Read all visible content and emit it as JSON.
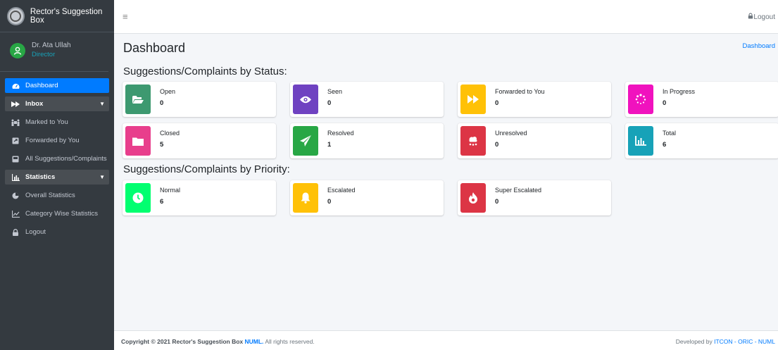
{
  "brand": {
    "title": "Rector's Suggestion Box"
  },
  "user": {
    "name": "Dr. Ata Ullah",
    "role": "Director"
  },
  "nav": {
    "dashboard": "Dashboard",
    "inbox": "Inbox",
    "marked_to_you": "Marked to You",
    "forwarded_by_you": "Forwarded by You",
    "all_suggestions": "All Suggestions/Complaints",
    "statistics": "Statistics",
    "overall_statistics": "Overall Statistics",
    "category_statistics": "Category Wise Statistics",
    "logout": "Logout"
  },
  "topbar": {
    "menu_icon": "≡",
    "logout": "Logout"
  },
  "page": {
    "title": "Dashboard",
    "breadcrumb": "Dashboard",
    "status_section": "Suggestions/Complaints by Status:",
    "priority_section": "Suggestions/Complaints by Priority:"
  },
  "status_cards": [
    {
      "label": "Open",
      "value": "0",
      "color": "#3d9970",
      "icon": "folder-open-icon"
    },
    {
      "label": "Seen",
      "value": "0",
      "color": "#6f42c1",
      "icon": "eye-icon"
    },
    {
      "label": "Forwarded to You",
      "value": "0",
      "color": "#ffc107",
      "icon": "fast-forward-icon"
    },
    {
      "label": "In Progress",
      "value": "0",
      "color": "#f012be",
      "icon": "spinner-icon"
    },
    {
      "label": "Closed",
      "value": "5",
      "color": "#e83e8c",
      "icon": "folder-icon"
    },
    {
      "label": "Resolved",
      "value": "1",
      "color": "#28a745",
      "icon": "paper-plane-icon"
    },
    {
      "label": "Unresolved",
      "value": "0",
      "color": "#dc3545",
      "icon": "cloud-rain-icon"
    },
    {
      "label": "Total",
      "value": "6",
      "color": "#17a2b8",
      "icon": "chart-bar-icon"
    }
  ],
  "priority_cards": [
    {
      "label": "Normal",
      "value": "6",
      "color": "#01ff70",
      "icon": "clock-icon"
    },
    {
      "label": "Escalated",
      "value": "0",
      "color": "#ffc107",
      "icon": "bell-icon"
    },
    {
      "label": "Super Escalated",
      "value": "0",
      "color": "#dc3545",
      "icon": "fire-icon"
    }
  ],
  "footer": {
    "copyright_prefix": "Copyright © 2021 Rector's Suggestion Box",
    "org": "NUML.",
    "rights": "All rights reserved.",
    "developed_by": "Developed by",
    "developer": "ITCON - ORIC - NUML"
  }
}
